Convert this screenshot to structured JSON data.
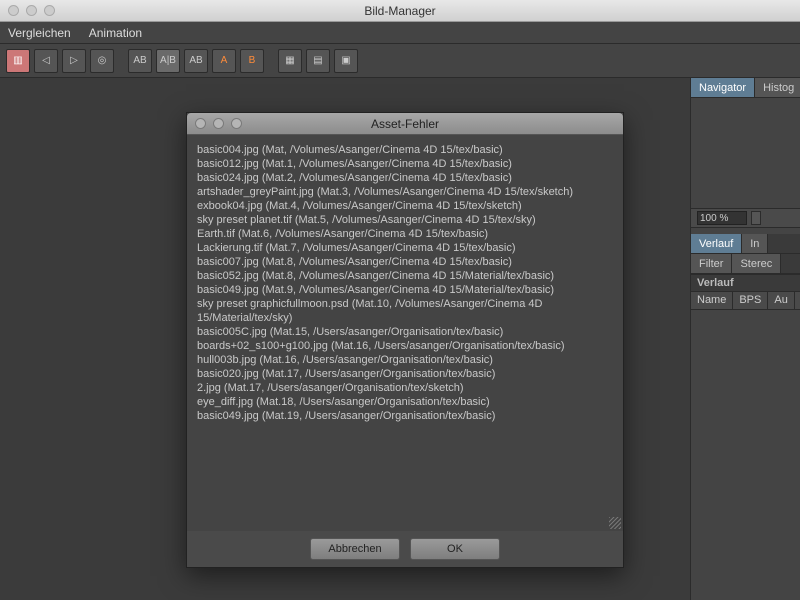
{
  "window": {
    "title": "Bild-Manager"
  },
  "menubar": {
    "items": [
      "Vergleichen",
      "Animation"
    ]
  },
  "toolbar": {
    "buttons": [
      {
        "name": "film-icon",
        "glyph": "▥"
      },
      {
        "name": "frame-prev-icon",
        "glyph": "◁"
      },
      {
        "name": "frame-next-icon",
        "glyph": "▷"
      },
      {
        "name": "circle-icon",
        "glyph": "◎"
      },
      {
        "name": "ab-compare-icon",
        "glyph": "AB"
      },
      {
        "name": "ab-split-icon",
        "glyph": "A|B"
      },
      {
        "name": "ab-diff-icon",
        "glyph": "AB"
      },
      {
        "name": "swap-a-icon",
        "glyph": "A"
      },
      {
        "name": "swap-b-icon",
        "glyph": "B"
      },
      {
        "name": "grid-icon",
        "glyph": "▦"
      },
      {
        "name": "tiles-icon",
        "glyph": "▤"
      },
      {
        "name": "layout-icon",
        "glyph": "▣"
      }
    ]
  },
  "sidepanel": {
    "top_tabs": [
      {
        "label": "Navigator",
        "selected": true
      },
      {
        "label": "Histog",
        "selected": false
      }
    ],
    "zoom_value": "100 %",
    "mid_tabs": [
      {
        "label": "Verlauf",
        "selected": true
      },
      {
        "label": "In",
        "selected": false
      }
    ],
    "mid_tabs2": [
      {
        "label": "Filter",
        "selected": false
      },
      {
        "label": "Sterec",
        "selected": false
      }
    ],
    "section_title": "Verlauf",
    "columns": [
      "Name",
      "BPS",
      "Au"
    ]
  },
  "dialog": {
    "title": "Asset-Fehler",
    "errors": [
      "basic004.jpg (Mat, /Volumes/Asanger/Cinema 4D 15/tex/basic)",
      "basic012.jpg (Mat.1, /Volumes/Asanger/Cinema 4D 15/tex/basic)",
      "basic024.jpg (Mat.2, /Volumes/Asanger/Cinema 4D 15/tex/basic)",
      "artshader_greyPaint.jpg (Mat.3, /Volumes/Asanger/Cinema 4D 15/tex/sketch)",
      "exbook04.jpg (Mat.4, /Volumes/Asanger/Cinema 4D 15/tex/sketch)",
      "sky preset planet.tif (Mat.5, /Volumes/Asanger/Cinema 4D 15/tex/sky)",
      "Earth.tif (Mat.6, /Volumes/Asanger/Cinema 4D 15/tex/basic)",
      "Lackierung.tif (Mat.7, /Volumes/Asanger/Cinema 4D 15/tex/basic)",
      "basic007.jpg (Mat.8, /Volumes/Asanger/Cinema 4D 15/tex/basic)",
      "basic052.jpg (Mat.8, /Volumes/Asanger/Cinema 4D 15/Material/tex/basic)",
      "basic049.jpg (Mat.9, /Volumes/Asanger/Cinema 4D 15/Material/tex/basic)",
      "sky preset graphicfullmoon.psd (Mat.10, /Volumes/Asanger/Cinema 4D 15/Material/tex/sky)",
      "basic005C.jpg (Mat.15, /Users/asanger/Organisation/tex/basic)",
      "boards+02_s100+g100.jpg (Mat.16, /Users/asanger/Organisation/tex/basic)",
      "hull003b.jpg (Mat.16, /Users/asanger/Organisation/tex/basic)",
      "basic020.jpg (Mat.17, /Users/asanger/Organisation/tex/basic)",
      "2.jpg (Mat.17, /Users/asanger/Organisation/tex/sketch)",
      "eye_diff.jpg (Mat.18, /Users/asanger/Organisation/tex/basic)",
      "basic049.jpg (Mat.19, /Users/asanger/Organisation/tex/basic)"
    ],
    "cancel_label": "Abbrechen",
    "ok_label": "OK"
  }
}
